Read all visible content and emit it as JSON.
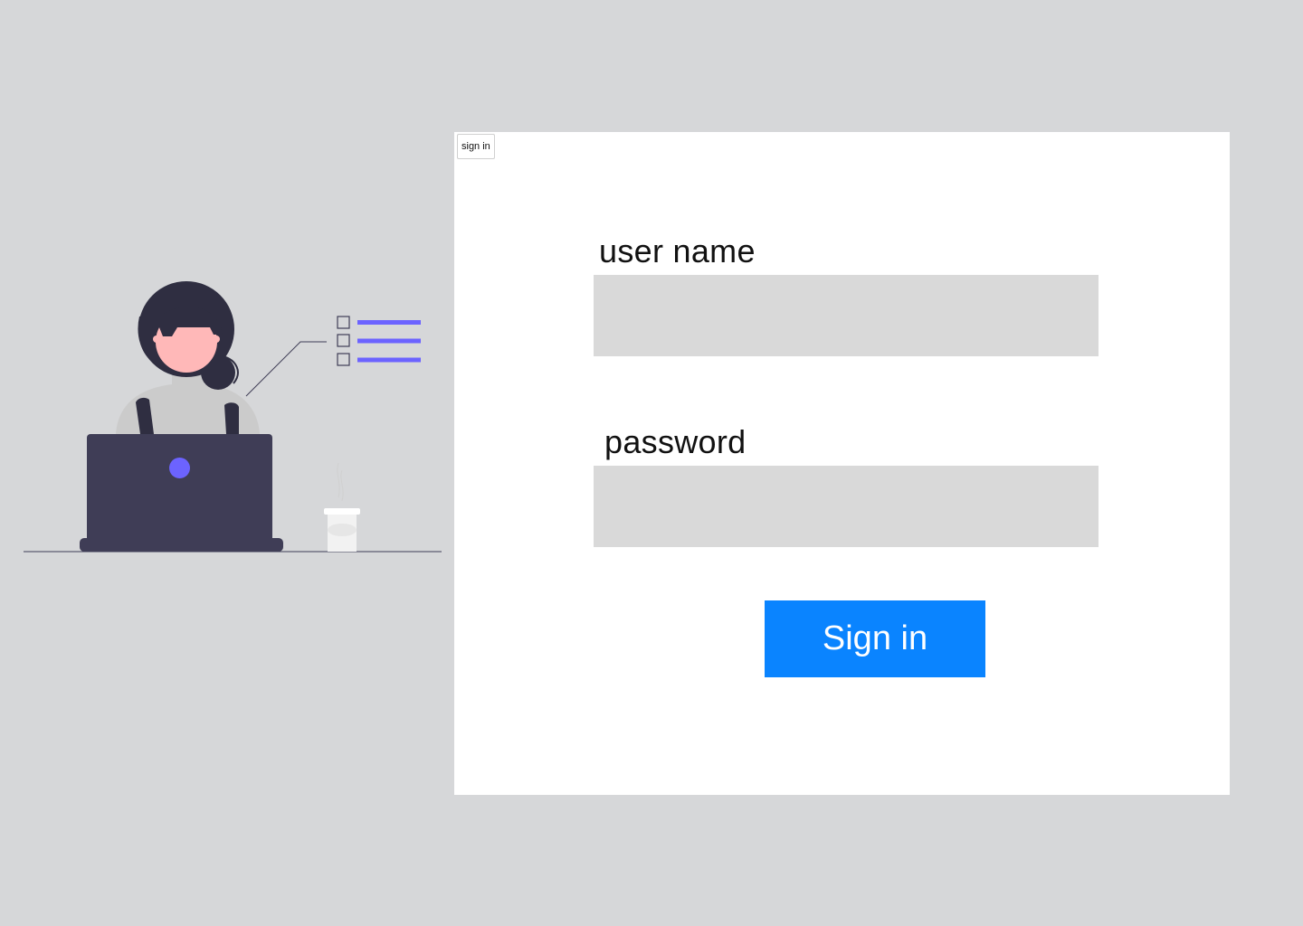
{
  "colors": {
    "page_background": "#d6d7d9",
    "card_background": "#ffffff",
    "input_background": "#d9d9d9",
    "primary_button": "#0a84ff",
    "illustration_accent": "#6c63ff",
    "illustration_dark": "#3f3d56"
  },
  "header": {
    "tab_label": "sign in"
  },
  "form": {
    "username_label": "user name",
    "username_value": "",
    "password_label": "password",
    "password_value": "",
    "submit_label": "Sign in"
  },
  "illustration": {
    "name": "woman-working-on-laptop-illustration",
    "icons": [
      "checkbox-icon",
      "checkbox-icon",
      "checkbox-icon",
      "coffee-cup-icon",
      "laptop-icon"
    ]
  }
}
